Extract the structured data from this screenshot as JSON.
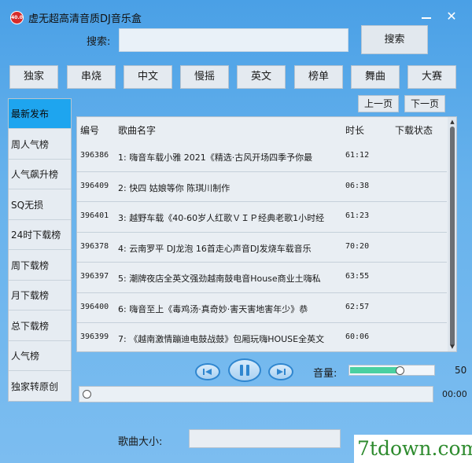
{
  "window": {
    "title": "虚无超高清音质DJ音乐盒",
    "logo_text": "40.0",
    "close_label": "✕"
  },
  "search": {
    "label": "搜索:",
    "value": "",
    "button_label": "搜索"
  },
  "categories": [
    "独家",
    "串烧",
    "中文",
    "慢摇",
    "英文",
    "榜单",
    "舞曲",
    "大赛"
  ],
  "sidebar": {
    "items": [
      "最新发布",
      "周人气榜",
      "人气飙升榜",
      "SQ无损",
      "24时下载榜",
      "周下载榜",
      "月下载榜",
      "总下载榜",
      "人气榜",
      "独家转原创"
    ],
    "active_index": 0
  },
  "pagination": {
    "prev_label": "上一页",
    "next_label": "下一页"
  },
  "table": {
    "headers": {
      "id": "编号",
      "name": "歌曲名字",
      "duration": "时长",
      "status": "下载状态"
    },
    "rows": [
      {
        "id": "396386",
        "name": "1: 嗨音车载小雅 2021《精选·古风开场四季予你最",
        "duration": "61:12",
        "status": ""
      },
      {
        "id": "396409",
        "name": "2: 快四 姑娘等你 陈琪川制作",
        "duration": "06:38",
        "status": ""
      },
      {
        "id": "396401",
        "name": "3: 越野车载《40-60岁人红歌ＶＩＰ经典老歌1小时经",
        "duration": "61:23",
        "status": ""
      },
      {
        "id": "396378",
        "name": "4: 云南罗平 DJ龙泡  16首走心声音DJ发烧车载音乐",
        "duration": "70:20",
        "status": ""
      },
      {
        "id": "396397",
        "name": "5: 潮牌夜店全英文强劲越南鼓电音House商业土嗨私",
        "duration": "63:55",
        "status": ""
      },
      {
        "id": "396400",
        "name": "6: 嗨音至上《毒鸡汤·真奇妙·害天害地害年少》恭",
        "duration": "62:57",
        "status": ""
      },
      {
        "id": "396399",
        "name": "7: 《越南激情蹦迪电鼓战鼓》包厢玩嗨HOUSE全英文",
        "duration": "60:06",
        "status": ""
      }
    ]
  },
  "player": {
    "volume_label": "音量:",
    "volume_value": "50",
    "volume_level": 0.6,
    "time": "00:00",
    "progress": 0
  },
  "size": {
    "label": "歌曲大小:",
    "value": ""
  },
  "watermark": "7tdown.com",
  "colors": {
    "accent": "#1ea5ef",
    "window_bg": "#5aa8ea",
    "volume_fill": "#4ad0a0"
  },
  "icons": [
    "app-logo-icon",
    "minimize-icon",
    "close-icon",
    "previous-icon",
    "pause-icon",
    "next-icon"
  ]
}
